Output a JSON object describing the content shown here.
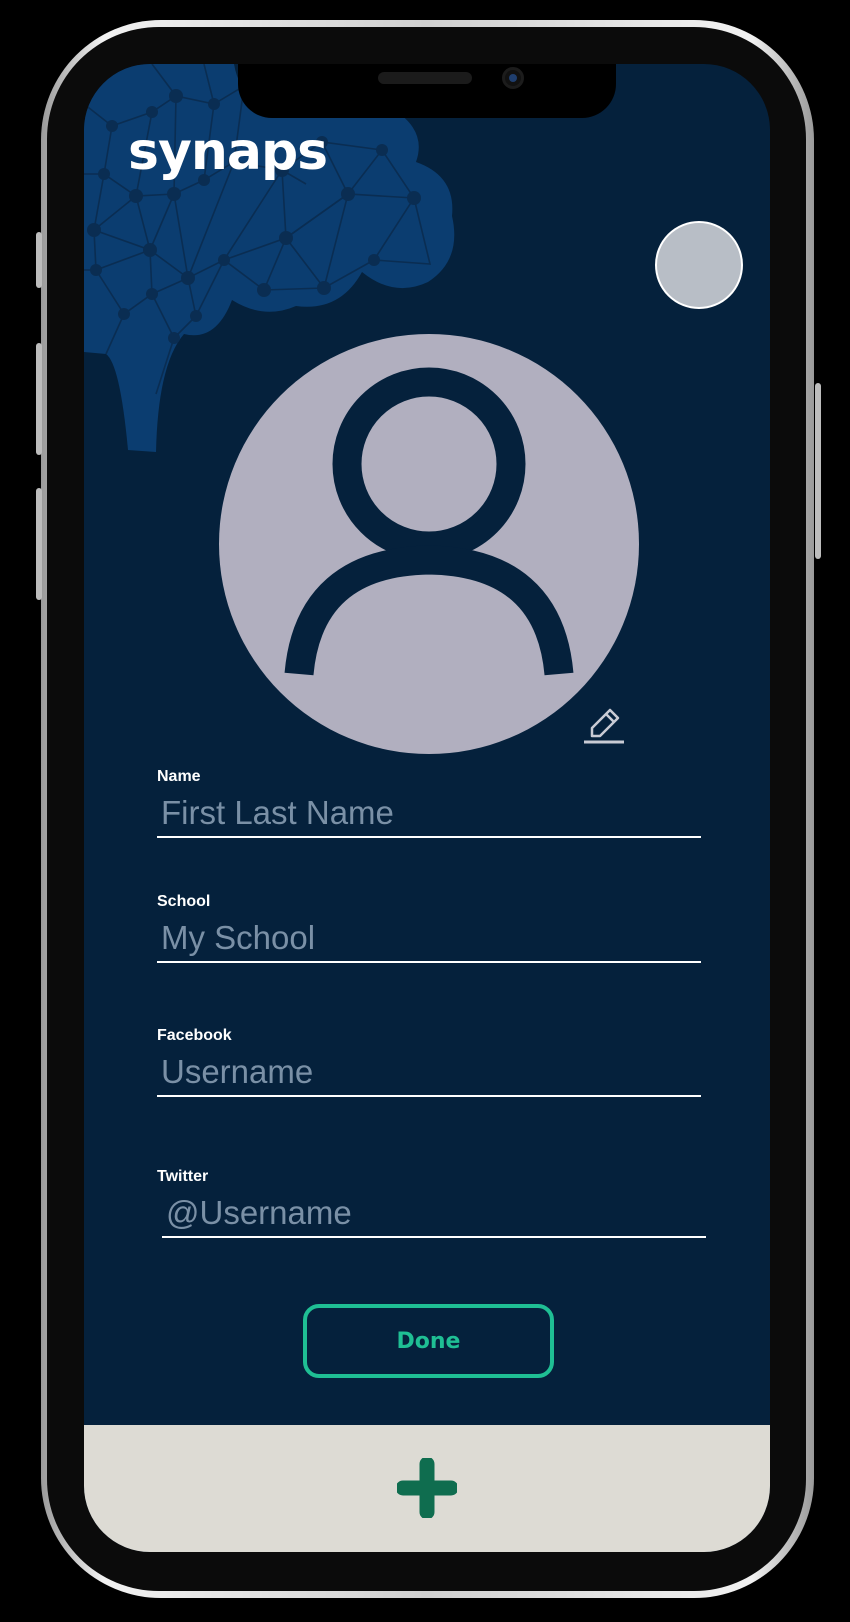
{
  "app": {
    "logo": "synaps"
  },
  "form": {
    "name": {
      "label": "Name",
      "placeholder": "First Last Name"
    },
    "school": {
      "label": "School",
      "placeholder": "My School"
    },
    "facebook": {
      "label": "Facebook",
      "placeholder": "Username"
    },
    "twitter": {
      "label": "Twitter",
      "placeholder": "@Username"
    }
  },
  "actions": {
    "done_label": "Done"
  },
  "icons": {
    "profile": "person-icon",
    "edit": "pencil-icon",
    "add": "plus-icon"
  },
  "colors": {
    "background": "#05213c",
    "brain": "#0b3d70",
    "accent": "#1fbf94",
    "add_button": "#0f6d4f",
    "avatar_fill": "#b1afbf",
    "bottom_bar": "#dddbd4"
  }
}
